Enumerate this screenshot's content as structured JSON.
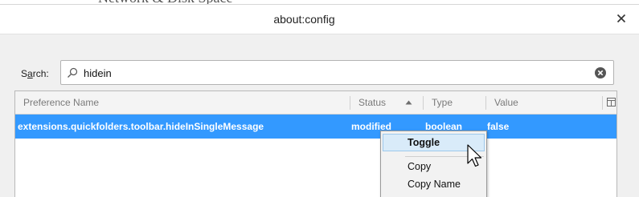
{
  "background": {
    "partial_text": "Network & Disk Space"
  },
  "dialog": {
    "title": "about:config",
    "close_icon": "close-icon"
  },
  "search": {
    "label": "Search:",
    "mnemonic": "a",
    "value": "hidein",
    "icon": "search-icon",
    "clear_icon": "clear-icon"
  },
  "table": {
    "columns": [
      "Preference Name",
      "Status",
      "Type",
      "Value"
    ],
    "sorted_column": "Status",
    "sort_direction": "ascending",
    "rows": [
      {
        "name": "extensions.quickfolders.toolbar.hideInSingleMessage",
        "status": "modified",
        "type": "boolean",
        "value": "false",
        "selected": true
      }
    ]
  },
  "context_menu": {
    "items": [
      "Toggle",
      "Copy",
      "Copy Name"
    ],
    "active_item": "Toggle"
  },
  "colors": {
    "selection": "#3399ff",
    "menu_highlight": "#d9ebf9"
  }
}
